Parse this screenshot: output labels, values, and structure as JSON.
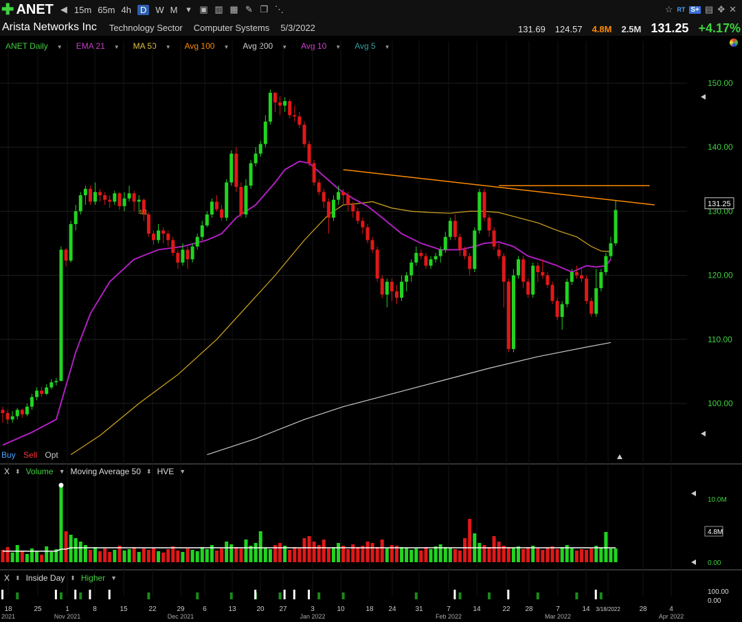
{
  "toolbar": {
    "symbol": "ANET",
    "timeframes": [
      "15m",
      "65m",
      "4h",
      "D",
      "W",
      "M"
    ],
    "active_timeframe": "D",
    "rt_label": "RT",
    "s_label": "S+"
  },
  "info": {
    "company": "Arista Networks Inc",
    "sector": "Technology Sector",
    "industry": "Computer Systems",
    "date": "5/3/2022",
    "high": "131.69",
    "low": "124.57",
    "volume": "4.8M",
    "avg_volume": "2.5M",
    "last": "131.25",
    "change": "+4.17%"
  },
  "legend": {
    "items": [
      {
        "label": "ANET Daily",
        "color": "#3fd13f"
      },
      {
        "label": "EMA 21",
        "color": "#c040c0"
      },
      {
        "label": "MA 50",
        "color": "#e0c040"
      },
      {
        "label": "Avg 100",
        "color": "#ff8a00"
      },
      {
        "label": "Avg 200",
        "color": "#cfcfcf"
      },
      {
        "label": "Avg 10",
        "color": "#d040d0"
      },
      {
        "label": "Avg 5",
        "color": "#30a0a0"
      }
    ]
  },
  "trade": {
    "buy": "Buy",
    "sell": "Sell",
    "opt": "Opt"
  },
  "volume_panel": {
    "close": "X",
    "label": "Volume",
    "ma_label": "Moving Average 50",
    "hve": "HVE"
  },
  "indicator_panel": {
    "close": "X",
    "label1": "Inside Day",
    "label2": "Higher"
  },
  "colors": {
    "up": "#21d421",
    "down": "#e01818",
    "ema21": "#b020c0",
    "ma50": "#d4a820",
    "avg200": "#c8c8c8",
    "trend": "#ff8a00"
  },
  "chart_data": {
    "type": "candlestick",
    "y_axis_ticks": [
      "150.00",
      "140.00",
      "130.00",
      "120.00",
      "110.00",
      "100.00"
    ],
    "ylim": [
      92,
      155
    ],
    "last_price_label": "131.25",
    "split_annotation": "4/1",
    "x_tick_labels": [
      {
        "label": "18",
        "sub": "2021"
      },
      {
        "label": "25",
        "sub": ""
      },
      {
        "label": "1",
        "sub": "Nov 2021"
      },
      {
        "label": "8",
        "sub": ""
      },
      {
        "label": "15",
        "sub": ""
      },
      {
        "label": "22",
        "sub": ""
      },
      {
        "label": "29",
        "sub": "Dec 2021"
      },
      {
        "label": "6",
        "sub": ""
      },
      {
        "label": "13",
        "sub": ""
      },
      {
        "label": "20",
        "sub": ""
      },
      {
        "label": "27",
        "sub": ""
      },
      {
        "label": "3",
        "sub": "Jan 2022"
      },
      {
        "label": "10",
        "sub": ""
      },
      {
        "label": "18",
        "sub": ""
      },
      {
        "label": "24",
        "sub": ""
      },
      {
        "label": "31",
        "sub": ""
      },
      {
        "label": "7",
        "sub": "Feb 2022"
      },
      {
        "label": "14",
        "sub": ""
      },
      {
        "label": "22",
        "sub": ""
      },
      {
        "label": "28",
        "sub": ""
      },
      {
        "label": "7",
        "sub": "Mar 2022"
      },
      {
        "label": "14",
        "sub": ""
      },
      {
        "label": "3/18/2022",
        "sub": ""
      },
      {
        "label": "28",
        "sub": ""
      },
      {
        "label": "4",
        "sub": "Apr 2022"
      }
    ],
    "candles": [
      [
        99,
        98.5,
        99.5,
        97
      ],
      [
        98.5,
        97.5,
        99,
        96.8
      ],
      [
        97.5,
        98,
        98.8,
        97
      ],
      [
        98,
        99,
        99.3,
        97.5
      ],
      [
        99,
        98.3,
        99.2,
        97.8
      ],
      [
        98.3,
        99.5,
        100,
        98
      ],
      [
        99.5,
        101,
        101.5,
        99
      ],
      [
        101,
        102,
        102.5,
        100.5
      ],
      [
        102,
        101.5,
        102.6,
        101
      ],
      [
        101.5,
        102.5,
        103,
        101.3
      ],
      [
        102.5,
        103.3,
        103.8,
        102.2
      ],
      [
        103.3,
        103.5,
        104,
        102.8
      ],
      [
        103.5,
        124,
        124.5,
        121
      ],
      [
        124,
        122.3,
        124.3,
        121.4
      ],
      [
        122.3,
        128,
        128.5,
        122
      ],
      [
        128,
        130,
        131,
        127
      ],
      [
        130,
        132.5,
        133,
        129.5
      ],
      [
        132.5,
        133.5,
        134,
        131
      ],
      [
        133.5,
        131.5,
        134,
        131
      ],
      [
        131.5,
        133,
        134.5,
        131
      ],
      [
        133,
        132.5,
        133.5,
        131.5
      ],
      [
        132.5,
        131.8,
        133,
        131
      ],
      [
        131.8,
        131.5,
        132.5,
        130.5
      ],
      [
        131.5,
        132.8,
        133.2,
        131
      ],
      [
        132.8,
        130.8,
        133,
        130.2
      ],
      [
        130.8,
        132,
        133,
        130
      ],
      [
        132,
        132.8,
        134,
        131.5
      ],
      [
        132.8,
        131.5,
        133.2,
        130
      ],
      [
        131.5,
        131.8,
        132.5,
        130
      ],
      [
        131.8,
        129.5,
        132,
        128.5
      ],
      [
        129.5,
        126.5,
        129.8,
        126
      ],
      [
        126.5,
        125.5,
        127,
        124.8
      ],
      [
        125.5,
        127,
        128,
        125
      ],
      [
        127,
        126.5,
        127.5,
        125
      ],
      [
        126.5,
        125.5,
        127,
        124.5
      ],
      [
        125.5,
        123.5,
        126,
        123
      ],
      [
        123.5,
        122,
        124,
        121
      ],
      [
        122,
        124,
        125,
        121.5
      ],
      [
        124,
        122.5,
        124.5,
        121
      ],
      [
        122.5,
        124.5,
        125,
        122
      ],
      [
        124.5,
        126,
        126.5,
        124
      ],
      [
        126,
        127.8,
        128.5,
        125.5
      ],
      [
        127.8,
        129.5,
        130,
        127.5
      ],
      [
        129.5,
        131.5,
        132,
        129
      ],
      [
        131.5,
        130.3,
        132.5,
        130
      ],
      [
        130.3,
        129,
        131,
        128.5
      ],
      [
        129,
        134.5,
        135,
        128.5
      ],
      [
        134.5,
        139,
        139.5,
        134
      ],
      [
        139,
        133.8,
        140,
        133
      ],
      [
        133.8,
        129.5,
        134.5,
        129
      ],
      [
        129.5,
        134,
        135,
        129
      ],
      [
        134,
        137.5,
        138,
        133.5
      ],
      [
        137.5,
        139,
        140,
        137
      ],
      [
        139,
        140.5,
        141,
        138.5
      ],
      [
        140.5,
        144,
        145,
        140
      ],
      [
        144,
        148.5,
        149,
        143.5
      ],
      [
        148.5,
        147,
        148.6,
        145.5
      ],
      [
        147,
        146.5,
        148,
        145
      ],
      [
        146.5,
        147.2,
        147.8,
        145.5
      ],
      [
        147.2,
        145,
        147.5,
        144.5
      ],
      [
        145,
        144.8,
        146.5,
        144
      ],
      [
        144.8,
        143.5,
        145.5,
        143
      ],
      [
        143.5,
        140.5,
        144,
        140
      ],
      [
        140.5,
        137.5,
        141,
        137
      ],
      [
        137.5,
        134.5,
        138,
        134
      ],
      [
        134.5,
        133,
        135,
        132.5
      ],
      [
        133,
        131.5,
        133.5,
        130.5
      ],
      [
        131.5,
        129,
        132,
        126.5
      ],
      [
        129,
        131.8,
        132.5,
        128.5
      ],
      [
        131.8,
        133,
        134,
        131
      ],
      [
        133,
        132.5,
        133.5,
        131
      ],
      [
        132.5,
        131,
        133,
        130
      ],
      [
        131,
        130,
        131.5,
        129
      ],
      [
        130,
        128.5,
        130.5,
        128
      ],
      [
        128.5,
        127.5,
        129,
        126.5
      ],
      [
        127.5,
        125.5,
        128,
        125
      ],
      [
        125.5,
        124,
        126,
        123.5
      ],
      [
        124,
        119.5,
        124.5,
        119
      ],
      [
        119.5,
        117,
        120,
        116.5
      ],
      [
        117,
        119,
        119.5,
        115
      ],
      [
        119,
        117.5,
        119.5,
        116
      ],
      [
        117.5,
        116.5,
        118.5,
        115.5
      ],
      [
        116.5,
        119,
        120,
        116
      ],
      [
        119,
        120,
        120.5,
        117.5
      ],
      [
        120,
        122,
        122.5,
        119
      ],
      [
        122,
        123.5,
        124.5,
        121.5
      ],
      [
        123.5,
        123,
        124,
        122.5
      ],
      [
        123,
        121.5,
        123.5,
        121
      ],
      [
        121.5,
        122.5,
        123,
        121
      ],
      [
        122.5,
        123,
        123.5,
        122
      ],
      [
        123,
        124,
        124.5,
        122
      ],
      [
        124,
        126,
        126.8,
        123.5
      ],
      [
        126,
        128.5,
        129,
        125.5
      ],
      [
        128.5,
        126,
        129.5,
        125.5
      ],
      [
        126,
        124,
        126.5,
        123
      ],
      [
        124,
        123,
        124.5,
        122.5
      ],
      [
        123,
        121,
        123.5,
        120
      ],
      [
        121,
        127,
        127.5,
        120.5
      ],
      [
        127,
        133,
        133.5,
        126.5
      ],
      [
        133,
        129,
        133.5,
        128.5
      ],
      [
        129,
        127,
        129.5,
        126
      ],
      [
        127,
        124.5,
        127.5,
        124
      ],
      [
        124,
        123,
        125,
        122.5
      ],
      [
        123,
        119,
        123.5,
        115
      ],
      [
        119,
        108.5,
        119.5,
        108
      ],
      [
        108.5,
        120,
        121,
        108
      ],
      [
        120,
        122.5,
        123,
        119.5
      ],
      [
        122.5,
        119,
        123,
        118
      ],
      [
        119,
        117,
        119.5,
        116.5
      ],
      [
        117,
        121.5,
        122,
        116.5
      ],
      [
        121.5,
        120.5,
        122,
        119
      ],
      [
        120.5,
        120,
        122.5,
        119.5
      ],
      [
        120,
        118.5,
        120.5,
        118
      ],
      [
        118.5,
        116,
        119,
        115.5
      ],
      [
        116,
        113.5,
        116.5,
        113
      ],
      [
        113.5,
        115.5,
        116,
        111.5
      ],
      [
        115.5,
        119,
        119.5,
        115
      ],
      [
        119,
        120.5,
        121,
        118.5
      ],
      [
        120.5,
        120,
        121.5,
        119.5
      ],
      [
        120,
        119.5,
        121,
        119
      ],
      [
        119.5,
        116,
        120,
        115.5
      ],
      [
        116,
        114,
        116.5,
        113.5
      ],
      [
        114,
        118,
        121,
        113.5
      ],
      [
        118,
        120.5,
        121,
        117.5
      ],
      [
        120.5,
        123,
        123.5,
        120
      ],
      [
        123,
        125,
        126,
        122.5
      ],
      [
        125,
        130.2,
        131.7,
        124.6
      ]
    ],
    "ema21": [
      [
        0,
        93.5
      ],
      [
        6,
        95.5
      ],
      [
        11,
        97.5
      ],
      [
        15,
        108
      ],
      [
        18,
        114
      ],
      [
        22,
        119
      ],
      [
        27,
        122.5
      ],
      [
        32,
        124
      ],
      [
        37,
        124.5
      ],
      [
        42,
        125.5
      ],
      [
        45,
        126.5
      ],
      [
        48,
        129
      ],
      [
        52,
        131
      ],
      [
        56,
        134.5
      ],
      [
        58,
        136.5
      ],
      [
        61,
        137.8
      ],
      [
        63,
        137.5
      ],
      [
        66,
        135.5
      ],
      [
        69,
        133.5
      ],
      [
        72,
        132
      ],
      [
        75,
        130.8
      ],
      [
        78,
        129
      ],
      [
        82,
        126.5
      ],
      [
        86,
        125
      ],
      [
        90,
        124
      ],
      [
        94,
        124
      ],
      [
        97,
        124.5
      ],
      [
        99,
        125
      ],
      [
        102,
        125.2
      ],
      [
        105,
        124.5
      ],
      [
        108,
        123
      ],
      [
        111,
        122.3
      ],
      [
        114,
        121.5
      ],
      [
        117,
        120.5
      ],
      [
        120,
        121.5
      ],
      [
        122,
        121.3
      ],
      [
        124,
        121.5
      ],
      [
        125,
        122.5
      ]
    ],
    "ma50": [
      [
        14,
        92
      ],
      [
        20,
        95
      ],
      [
        28,
        100
      ],
      [
        36,
        104.5
      ],
      [
        44,
        110
      ],
      [
        50,
        115
      ],
      [
        56,
        120
      ],
      [
        62,
        125.5
      ],
      [
        67,
        129.5
      ],
      [
        70,
        131
      ],
      [
        73,
        131.2
      ],
      [
        76,
        131.5
      ],
      [
        80,
        130.5
      ],
      [
        84,
        130
      ],
      [
        88,
        129.8
      ],
      [
        92,
        129.7
      ],
      [
        96,
        130
      ],
      [
        99,
        130
      ],
      [
        102,
        129.8
      ],
      [
        106,
        129
      ],
      [
        110,
        128.2
      ],
      [
        114,
        127
      ],
      [
        118,
        126
      ],
      [
        121,
        124.5
      ],
      [
        123,
        123.8
      ],
      [
        125,
        123.7
      ]
    ],
    "avg200": [
      [
        42,
        92
      ],
      [
        52,
        94.5
      ],
      [
        62,
        97.5
      ],
      [
        70,
        99.5
      ],
      [
        80,
        101.5
      ],
      [
        90,
        103.5
      ],
      [
        100,
        105.5
      ],
      [
        110,
        107.3
      ],
      [
        120,
        108.8
      ],
      [
        125,
        109.5
      ]
    ],
    "trendlines": [
      [
        [
          70,
          136.5
        ],
        [
          134,
          131
        ]
      ],
      [
        [
          102,
          134
        ],
        [
          133,
          134
        ]
      ]
    ],
    "volume": {
      "ma_line_value": "4.8M",
      "y_ticks": [
        "10.0M",
        "4.8M",
        "0.00"
      ]
    },
    "indicator_axis": [
      "100.00",
      "0.00"
    ]
  }
}
